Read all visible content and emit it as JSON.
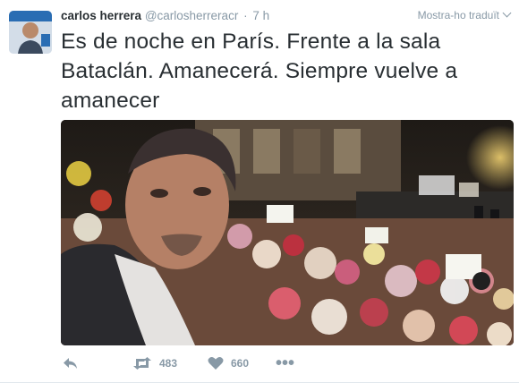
{
  "author": {
    "name": "carlos herrera",
    "handle": "@carlosherreracr",
    "separator": "·",
    "time": "7 h"
  },
  "translate_label": "Mostra-ho traduït",
  "tweet_text": "Es de noche en París. Frente a la sala Bataclán. Amanecerá. Siempre vuelve a amanecer",
  "actions": {
    "reply_icon": "reply-icon",
    "retweet_icon": "retweet-icon",
    "retweet_count": "483",
    "like_icon": "heart-icon",
    "like_count": "660",
    "more_icon": "more-icon",
    "more_label": "•••"
  },
  "colors": {
    "text": "#292f33",
    "muted": "#8899a6",
    "divider": "#e1e8ed"
  }
}
